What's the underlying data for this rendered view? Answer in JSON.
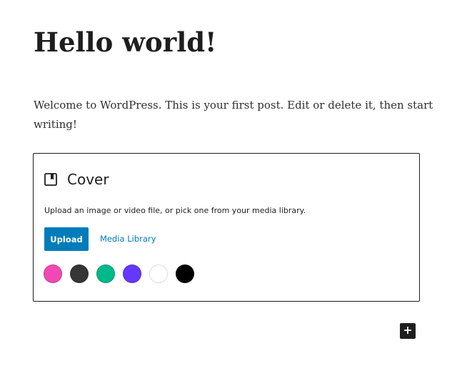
{
  "post": {
    "title": "Hello world!",
    "paragraph": "Welcome to WordPress. This is your first post. Edit or delete it, then start writing!"
  },
  "cover_block": {
    "icon": "cover-icon",
    "title": "Cover",
    "instructions": "Upload an image or video file, or pick one from your media library.",
    "upload_label": "Upload",
    "media_library_label": "Media Library",
    "swatch_colors": [
      "#f049b4",
      "#363636",
      "#00b98a",
      "#6438ff",
      "#ffffff",
      "#000000"
    ]
  },
  "add_block": {
    "icon": "plus-icon"
  },
  "colors": {
    "accent": "#007cba",
    "text": "#1e1e1e"
  }
}
